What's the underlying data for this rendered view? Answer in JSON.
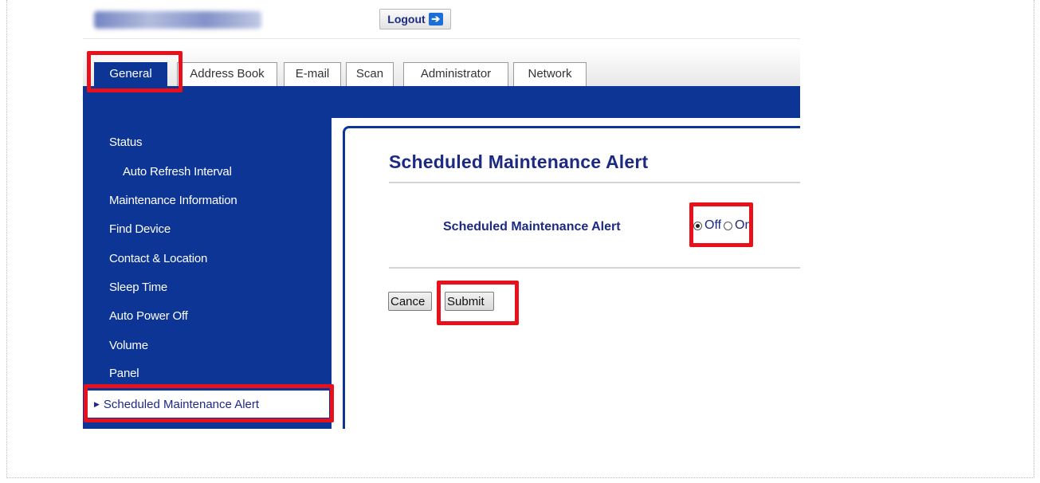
{
  "header": {
    "logout_label": "Logout",
    "logout_icon": "right-arrow-icon"
  },
  "tabs": [
    {
      "label": "General",
      "active": true
    },
    {
      "label": "Address Book",
      "active": false
    },
    {
      "label": "E-mail",
      "active": false
    },
    {
      "label": "Scan",
      "active": false
    },
    {
      "label": "Administrator",
      "active": false
    },
    {
      "label": "Network",
      "active": false
    }
  ],
  "sidebar": {
    "items": [
      {
        "label": "Status"
      },
      {
        "label": "Auto Refresh Interval"
      },
      {
        "label": "Maintenance Information"
      },
      {
        "label": "Find Device"
      },
      {
        "label": "Contact & Location"
      },
      {
        "label": "Sleep Time"
      },
      {
        "label": "Auto Power Off"
      },
      {
        "label": "Volume"
      },
      {
        "label": "Panel"
      },
      {
        "label": "Scheduled Maintenance Alert",
        "selected": true
      }
    ]
  },
  "main": {
    "title": "Scheduled Maintenance Alert",
    "field_label": "Scheduled Maintenance Alert",
    "radio_off_label": "Off",
    "radio_on_label": "On",
    "selected_option": "Off",
    "cancel_label": "Cance",
    "submit_label": "Submit"
  },
  "colors": {
    "brand_blue": "#0c3596",
    "text_blue": "#1c2a84",
    "highlight_red": "#e8101a"
  }
}
